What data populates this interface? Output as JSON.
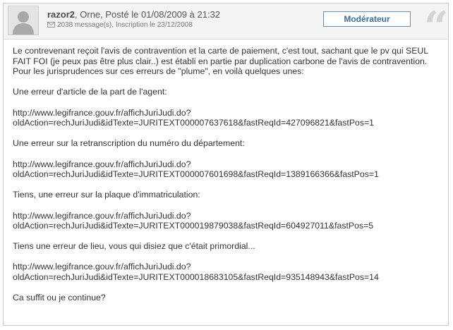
{
  "header": {
    "username": "razor2",
    "location": ", Orne, ",
    "posted": "Posté le 01/08/2009 à 21:32",
    "messages": "2038 message(s)",
    "registration": ", Inscription le 23/12/2008",
    "role_badge": "Modérateur",
    "icons": [
      "avatar-placeholder",
      "mail-icon",
      "quote-mark"
    ]
  },
  "body": {
    "p1": "Le contrevenant reçoit l'avis de contravention et la carte de paiement, c'est tout, sachant que le pv qui SEUL FAIT FOI (je peux pas être plus clair..) est établi en partie par duplication carbone de l'avis de contravention. Pour les jurisprudences sur ces erreurs de \"plume\", en voilà quelques unes:",
    "p2": "Une erreur d'article de la part de l'agent:",
    "link1_line1": "http://www.legifrance.gouv.fr/affichJuriJudi.do?",
    "link1_line2": "oldAction=rechJuriJudi&idTexte=JURITEXT000007637618&fastReqId=427096821&fastPos=1",
    "p3": "Une erreur sur la retranscription du numéro du département:",
    "link2_line1": "http://www.legifrance.gouv.fr/affichJuriJudi.do?",
    "link2_line2": "oldAction=rechJuriJudi&idTexte=JURITEXT000007601698&fastReqId=1389166366&fastPos=1",
    "p4": "Tiens, une erreur sur la plaque d'immatriculation:",
    "link3_line1": "http://www.legifrance.gouv.fr/affichJuriJudi.do?",
    "link3_line2": "oldAction=rechJuriJudi&idTexte=JURITEXT000019879038&fastReqId=604927011&fastPos=5",
    "p5": "Tiens une erreur de lieu, vous qui disiez que c'était primordial...",
    "link4_line1": "http://www.legifrance.gouv.fr/affichJuriJudi.do?",
    "link4_line2": "oldAction=rechJuriJudi&idTexte=JURITEXT000018683105&fastReqId=935148943&fastPos=14",
    "p6": "Ca suffit ou je continue?"
  }
}
